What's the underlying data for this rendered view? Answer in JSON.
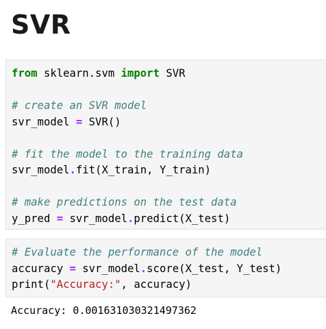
{
  "heading": "SVR",
  "cell1": {
    "line1": {
      "kw_from": "from",
      "mod": " sklearn.svm ",
      "kw_import": "import",
      "name": " SVR"
    },
    "comment1": "# create an SVR model",
    "line2": {
      "lhs": "svr_model ",
      "eq": "=",
      "rhs": " SVR()"
    },
    "comment2": "# fit the model to the training data",
    "line3": {
      "obj": "svr_model",
      "dot": ".",
      "call": "fit(X_train, Y_train)"
    },
    "comment3": "# make predictions on the test data",
    "line4": {
      "lhs": "y_pred ",
      "eq": "=",
      "mid": " svr_model",
      "dot": ".",
      "call": "predict(X_test)"
    }
  },
  "cell2": {
    "comment1": "# Evaluate the performance of the model",
    "line1": {
      "lhs": "accuracy ",
      "eq": "=",
      "mid": " svr_model",
      "dot": ".",
      "call": "score(X_test, Y_test)"
    },
    "line2": {
      "pre": "print(",
      "str": "\"Accuracy:\"",
      "post": ", accuracy)"
    }
  },
  "output": "Accuracy: 0.001631030321497362"
}
